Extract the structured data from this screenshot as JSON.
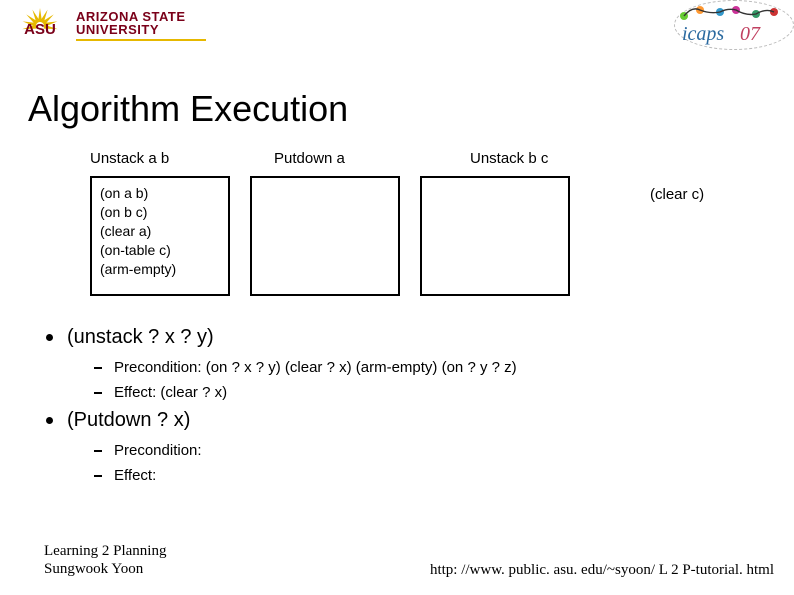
{
  "logo": {
    "asu_line1": "ARIZONA STATE",
    "asu_line2": "UNIVERSITY",
    "asu_initials": "ASU",
    "icaps_text": "icaps07"
  },
  "title": "Algorithm Execution",
  "steps": {
    "labels": [
      "Unstack a b",
      "Putdown a",
      "Unstack b c"
    ],
    "box1_lines": [
      "(on a b)",
      "(on b c)",
      "(clear a)",
      "(on-table c)",
      "(arm-empty)"
    ],
    "post_label": "(clear c)"
  },
  "bullets": {
    "unstack": "(unstack ? x ? y)",
    "unstack_pre": "Precondition: (on ? x ? y) (clear ? x)  (arm-empty) (on ? y ? z)",
    "unstack_eff": "Effect: (clear ? x)",
    "putdown": "(Putdown ? x)",
    "putdown_pre": "Precondition:",
    "putdown_eff": "Effect:"
  },
  "footer": {
    "left_line1": "Learning 2 Planning",
    "left_line2": "Sungwook Yoon",
    "right": "http: //www. public. asu. edu/~syoon/ L 2 P-tutorial. html"
  }
}
